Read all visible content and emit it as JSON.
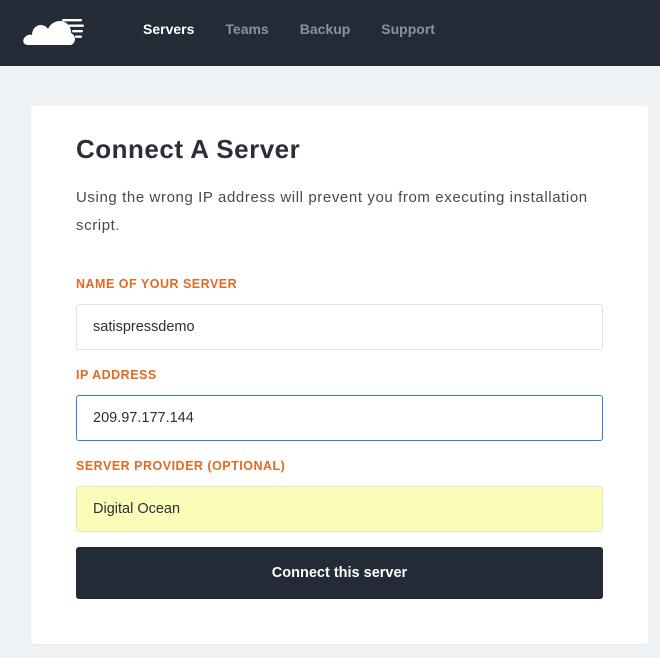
{
  "header": {
    "logo_icon": "cloud-speed-icon",
    "nav": [
      {
        "label": "Servers",
        "active": true
      },
      {
        "label": "Teams",
        "active": false
      },
      {
        "label": "Backup",
        "active": false
      },
      {
        "label": "Support",
        "active": false
      }
    ]
  },
  "form": {
    "title": "Connect A Server",
    "description": "Using the wrong IP address will prevent you from executing installation script.",
    "server_name": {
      "label": "NAME OF YOUR SERVER",
      "value": "satispressdemo"
    },
    "ip_address": {
      "label": "IP ADDRESS",
      "value": "209.97.177.144"
    },
    "provider": {
      "label": "SERVER PROVIDER (OPTIONAL)",
      "value": "Digital Ocean"
    },
    "submit_label": "Connect this server"
  },
  "colors": {
    "header_bg": "#232b36",
    "accent_label": "#e06a24",
    "focus_border": "#2f7fd1",
    "autofill_bg": "#fafcb8",
    "page_bg": "#eef2f5"
  }
}
